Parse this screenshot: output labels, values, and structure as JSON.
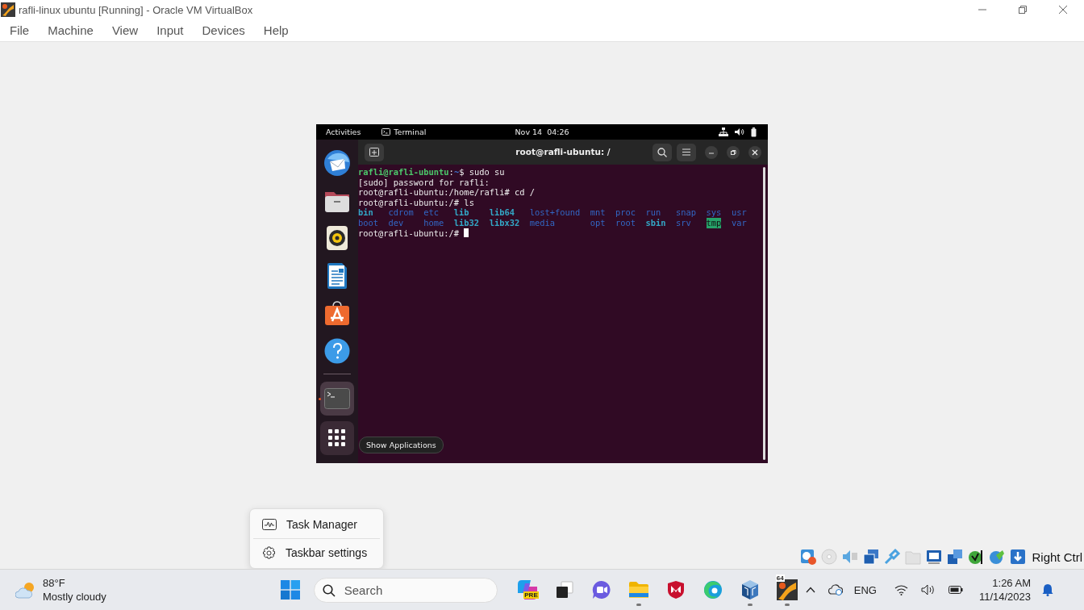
{
  "window": {
    "title": "rafli-linux ubuntu [Running] - Oracle VM VirtualBox"
  },
  "menu": [
    "File",
    "Machine",
    "View",
    "Input",
    "Devices",
    "Help"
  ],
  "vm": {
    "top_bar": {
      "activities": "Activities",
      "app": "Terminal",
      "clock": "Nov 14  04:26"
    },
    "dock": [
      {
        "kind": "mail",
        "running": false
      },
      {
        "kind": "files",
        "running": false
      },
      {
        "kind": "music",
        "running": false
      },
      {
        "kind": "writer",
        "running": false
      },
      {
        "kind": "store",
        "running": false
      },
      {
        "kind": "help",
        "running": false
      },
      {
        "kind": "terminal",
        "running": true
      }
    ],
    "tooltip": "Show Applications",
    "terminal": {
      "title": "root@rafli-ubuntu: /",
      "output": [
        {
          "kind": "line",
          "cursor": false,
          "segments": [
            {
              "kind": "user",
              "text": "rafli@rafli-ubuntu"
            },
            {
              "kind": "plain",
              "text": ":"
            },
            {
              "kind": "path",
              "text": "~"
            },
            {
              "kind": "plain",
              "text": "$ sudo su"
            }
          ]
        },
        {
          "kind": "line",
          "cursor": false,
          "segments": [
            {
              "kind": "plain",
              "text": "[sudo] password for rafli:"
            }
          ]
        },
        {
          "kind": "line",
          "cursor": false,
          "segments": [
            {
              "kind": "plain",
              "text": "root@rafli-ubuntu:/home/rafli# cd /"
            }
          ]
        },
        {
          "kind": "line",
          "cursor": false,
          "segments": [
            {
              "kind": "plain",
              "text": "root@rafli-ubuntu:/# ls"
            }
          ]
        },
        {
          "kind": "listing",
          "rows": [
            [
              {
                "name": "bin",
                "kind": "link"
              },
              {
                "name": "cdrom",
                "kind": "dir"
              },
              {
                "name": "etc",
                "kind": "dir"
              },
              {
                "name": "lib",
                "kind": "link"
              },
              {
                "name": "lib64",
                "kind": "link"
              },
              {
                "name": "lost+found",
                "kind": "dir"
              },
              {
                "name": "mnt",
                "kind": "dir"
              },
              {
                "name": "proc",
                "kind": "dir"
              },
              {
                "name": "run",
                "kind": "dir"
              },
              {
                "name": "snap",
                "kind": "dir"
              },
              {
                "name": "sys",
                "kind": "dir"
              },
              {
                "name": "usr",
                "kind": "dir"
              }
            ],
            [
              {
                "name": "boot",
                "kind": "dir"
              },
              {
                "name": "dev",
                "kind": "dir"
              },
              {
                "name": "home",
                "kind": "dir"
              },
              {
                "name": "lib32",
                "kind": "link"
              },
              {
                "name": "libx32",
                "kind": "link"
              },
              {
                "name": "media",
                "kind": "dir"
              },
              {
                "name": "opt",
                "kind": "dir"
              },
              {
                "name": "root",
                "kind": "dir"
              },
              {
                "name": "sbin",
                "kind": "link"
              },
              {
                "name": "srv",
                "kind": "dir"
              },
              {
                "name": "tmp",
                "kind": "sticky"
              },
              {
                "name": "var",
                "kind": "dir"
              }
            ]
          ]
        },
        {
          "kind": "line",
          "cursor": true,
          "segments": [
            {
              "kind": "plain",
              "text": "root@rafli-ubuntu:/# "
            }
          ]
        }
      ]
    }
  },
  "status_bar": {
    "host_key": "Right Ctrl"
  },
  "context_menu": [
    {
      "kind": "monitor",
      "label": "Task Manager"
    },
    {
      "kind": "settings",
      "label": "Taskbar settings"
    }
  ],
  "taskbar": {
    "weather": {
      "temp": "88°F",
      "condition": "Mostly cloudy"
    },
    "search": {
      "placeholder": "Search"
    },
    "apps": [
      {
        "kind": "copilot",
        "badge": "PRE",
        "running": false
      },
      {
        "kind": "taskview",
        "running": false
      },
      {
        "kind": "chat",
        "running": false
      },
      {
        "kind": "explorer",
        "running": true
      },
      {
        "kind": "shield",
        "running": false
      },
      {
        "kind": "edge",
        "running": false
      },
      {
        "kind": "vbox",
        "running": true
      },
      {
        "kind": "vm",
        "badge": "64",
        "running": true
      }
    ],
    "tray": {
      "language": "ENG",
      "time": "1:26 AM",
      "date": "11/14/2023"
    }
  }
}
